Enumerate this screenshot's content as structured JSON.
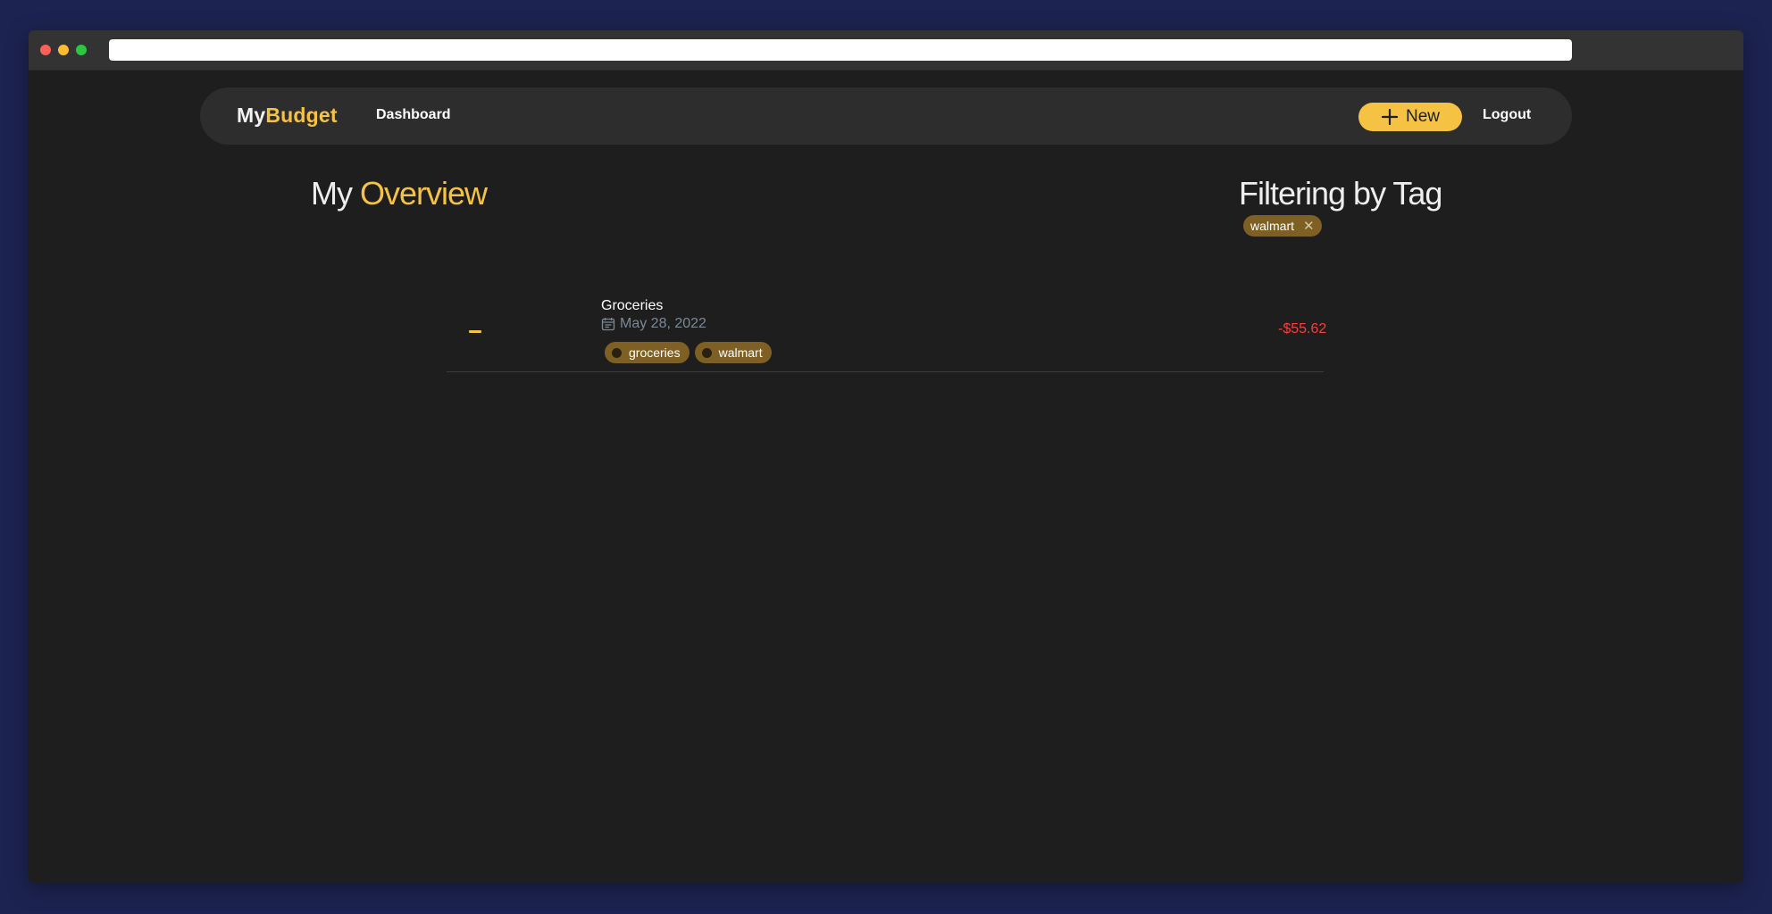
{
  "navbar": {
    "brand_prefix": "My",
    "brand_accent": "Budget",
    "dashboard_label": "Dashboard",
    "new_label": "New",
    "logout_label": "Logout"
  },
  "overview": {
    "title_prefix": "My",
    "title_accent": "Overview"
  },
  "filter": {
    "title": "Filtering by Tag",
    "active_tag": "walmart",
    "remove_symbol": "✕"
  },
  "transactions": [
    {
      "name": "Groceries",
      "date": "May 28, 2022",
      "amount": "-$55.62",
      "icon": "minus",
      "tags": [
        "groceries",
        "walmart"
      ]
    }
  ],
  "colors": {
    "accent": "#f6c244",
    "negative": "#ff3b3b",
    "tag_bg": "#7e6024",
    "page_bg": "#1e1e1e",
    "outer_bg": "#1c2350"
  }
}
